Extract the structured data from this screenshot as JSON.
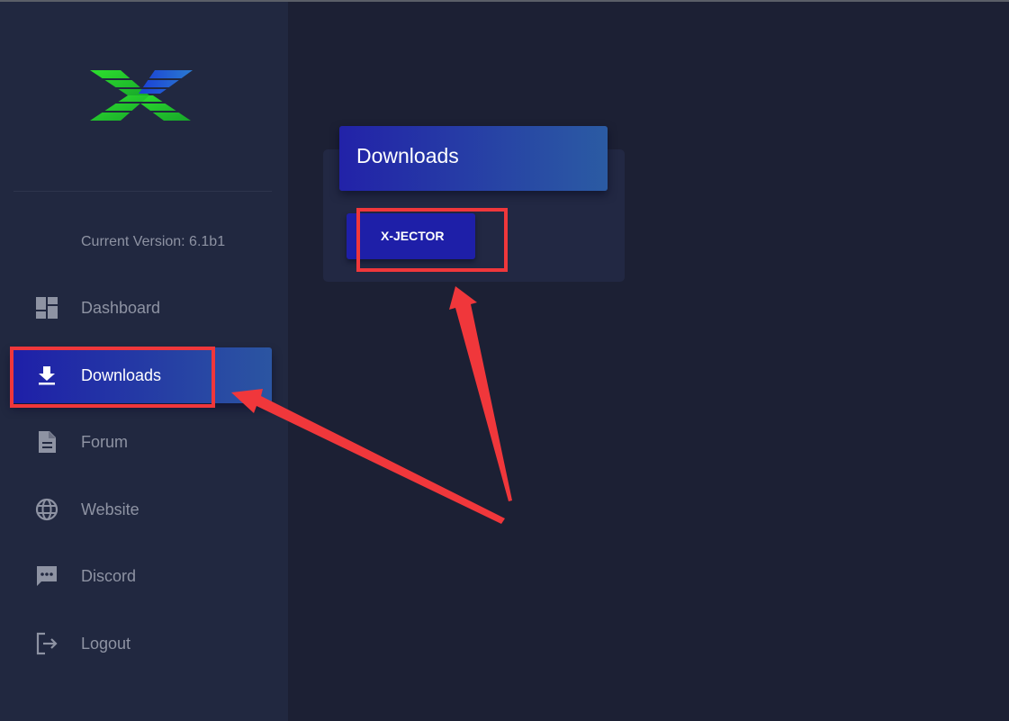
{
  "sidebar": {
    "logo": {
      "icon": "x-jector-logo-icon",
      "colors": [
        "#1fb51f",
        "#2ee02e",
        "#1a3fd6"
      ]
    },
    "version_text": "Current Version: 6.1b1",
    "items": [
      {
        "label": "Dashboard",
        "icon": "dashboard-icon",
        "active": false
      },
      {
        "label": "Downloads",
        "icon": "download-icon",
        "active": true
      },
      {
        "label": "Forum",
        "icon": "document-icon",
        "active": false
      },
      {
        "label": "Website",
        "icon": "globe-icon",
        "active": false
      },
      {
        "label": "Discord",
        "icon": "chat-icon",
        "active": false
      },
      {
        "label": "Logout",
        "icon": "logout-icon",
        "active": false
      }
    ]
  },
  "main": {
    "card_title": "Downloads",
    "download_button": "X-JECTOR"
  },
  "colors": {
    "background": "#1c2034",
    "sidebar": "#212840",
    "accent_start": "#1e1fa8",
    "accent_end": "#2b55a2",
    "annotation": "#f0373b"
  }
}
